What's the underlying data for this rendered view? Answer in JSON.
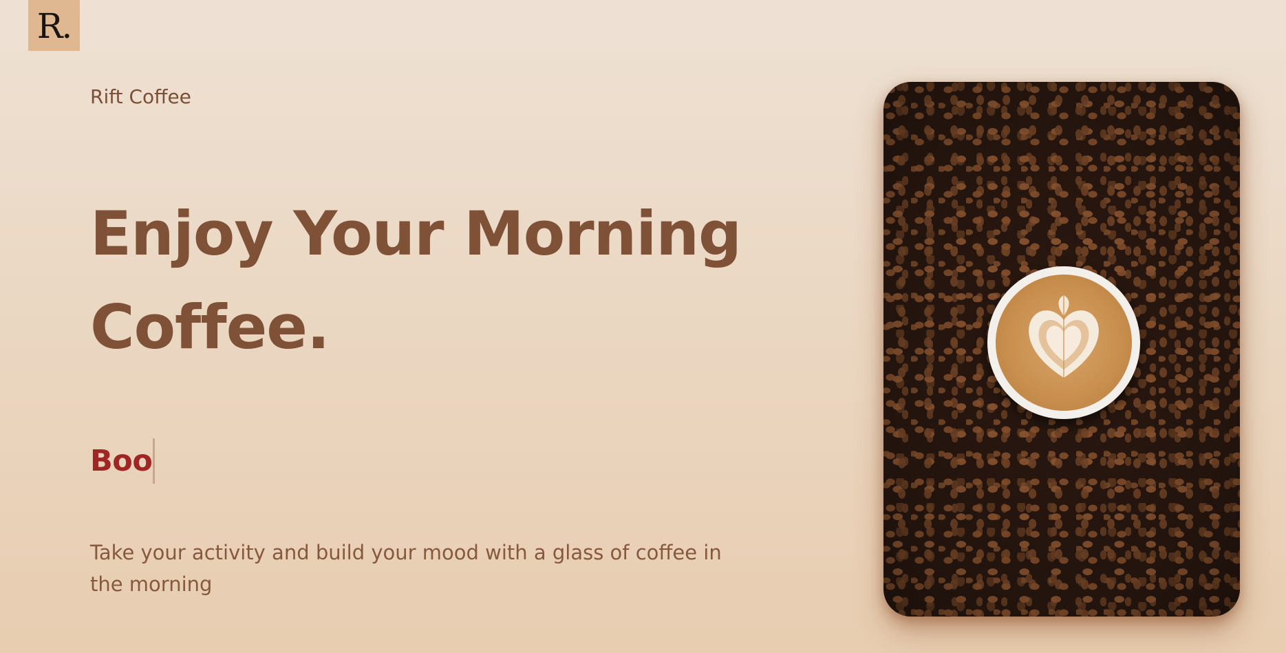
{
  "logo": {
    "text": "R."
  },
  "brand": {
    "name": "Rift Coffee"
  },
  "hero": {
    "headline": "Enjoy Your Morning Coffee.",
    "typed_text": "Boo",
    "description": "Take your activity and build your mood with a glass of coffee in the morning"
  },
  "image": {
    "subject": "latte art cup on coffee beans",
    "icon": "coffee-cup-icon"
  },
  "colors": {
    "background": "#eee1d4",
    "logo_bg": "#dfb790",
    "text_brown": "#7f5237",
    "typed_accent": "#9e2725"
  }
}
